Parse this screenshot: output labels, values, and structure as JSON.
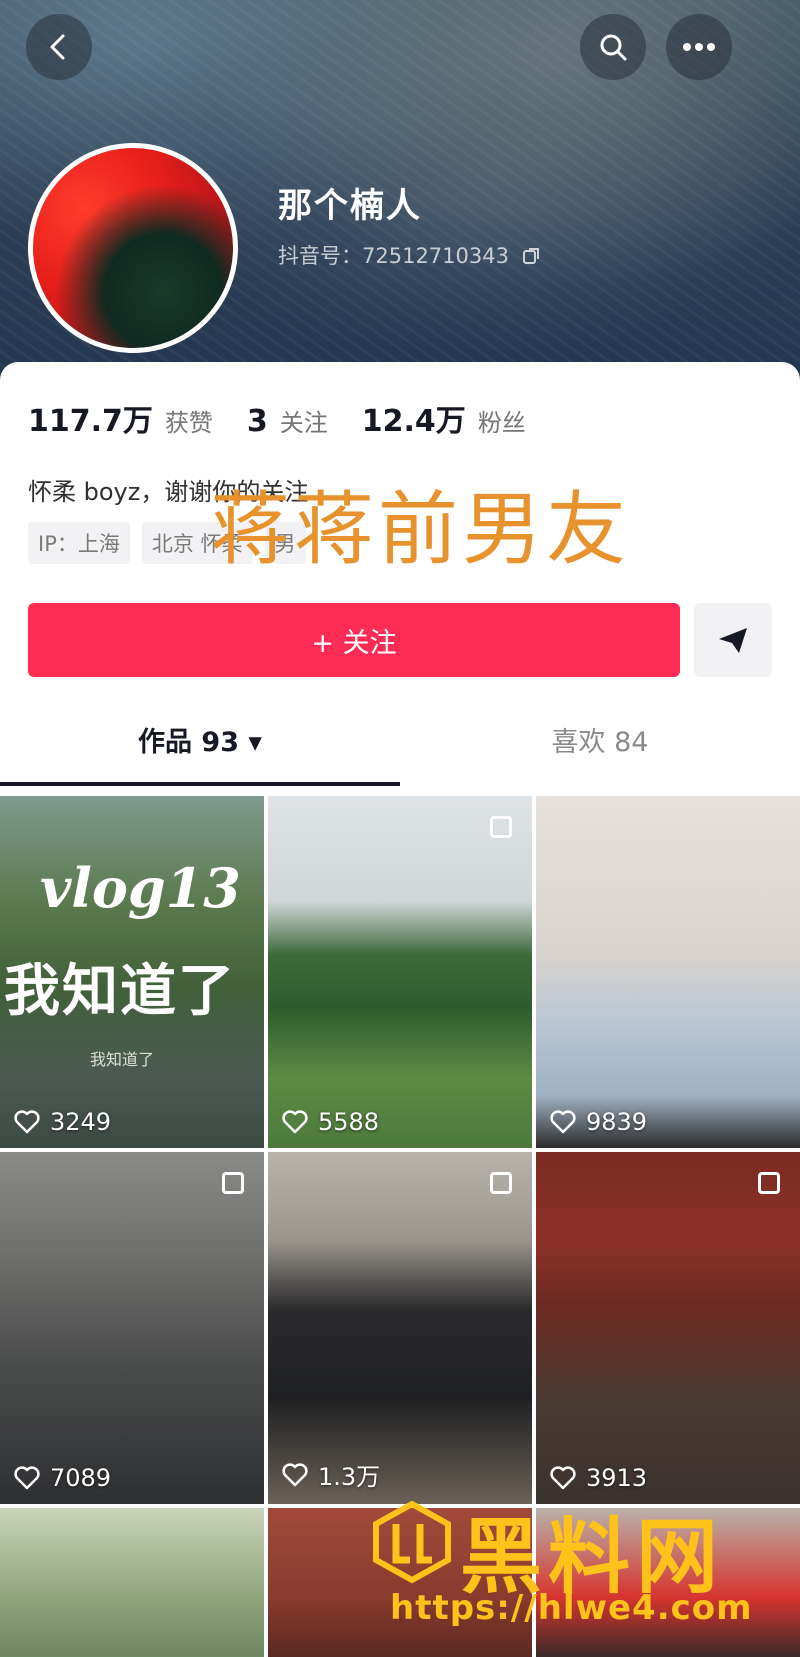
{
  "profile": {
    "nickname": "那个楠人",
    "douyin_id": "抖音号：72512710343"
  },
  "stats": [
    {
      "value": "117.7万",
      "label": "获赞"
    },
    {
      "value": "3",
      "label": "关注"
    },
    {
      "value": "12.4万",
      "label": "粉丝"
    }
  ],
  "bio": "怀柔 boyz，谢谢你的关注",
  "tags": [
    "IP：上海",
    "北京 怀柔",
    "男"
  ],
  "overlay_caption": "蒋蒋前男友",
  "actions": {
    "follow_label": "+ 关注"
  },
  "tabs": {
    "works_label": "作品 93 ▾",
    "likes_label": "喜欢 84"
  },
  "videos": [
    {
      "likes": "3249",
      "overlay_title": "vlog13",
      "overlay_subtitle": "我知道了",
      "overlay_small": "我知道了",
      "multi": false
    },
    {
      "likes": "5588",
      "multi": true
    },
    {
      "likes": "9839",
      "multi": false
    },
    {
      "likes": "7089",
      "multi": true
    },
    {
      "likes": "1.3万",
      "multi": true
    },
    {
      "likes": "3913",
      "multi": true
    }
  ],
  "site_watermark": {
    "title": "黑料网",
    "url": "https://hlwe4.com"
  },
  "colors": {
    "follow_red": "#fe2c55",
    "watermark_orange": "#e8922e",
    "site_gold": "#ffc21a"
  }
}
